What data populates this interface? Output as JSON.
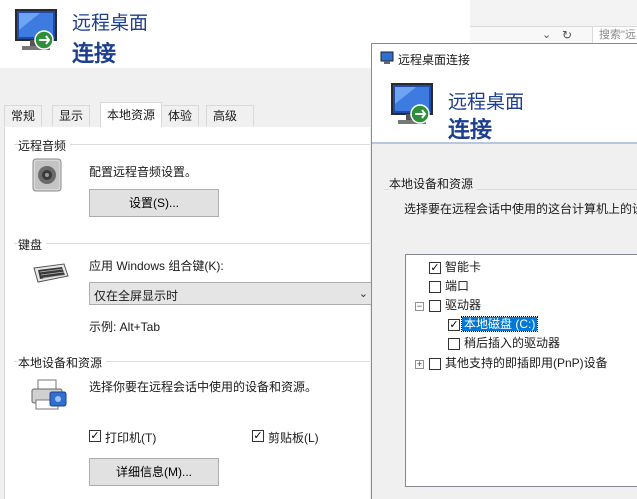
{
  "back": {
    "banner_line1": "远程桌面",
    "banner_line2": "连接",
    "tabs": [
      "常规",
      "显示",
      "本地资源",
      "体验",
      "高级"
    ],
    "audio": {
      "group_label": "远程音频",
      "description": "配置远程音频设置。",
      "settings_button": "设置(S)..."
    },
    "keyboard": {
      "group_label": "键盘",
      "description": "应用 Windows 组合键(K):",
      "combo_value": "仅在全屏显示时",
      "example": "示例: Alt+Tab"
    },
    "devices": {
      "group_label": "本地设备和资源",
      "description": "选择你要在远程会话中使用的设备和资源。",
      "printer_label": "打印机(T)",
      "clipboard_label": "剪贴板(L)",
      "details_button": "详细信息(M)..."
    }
  },
  "browser": {
    "search_placeholder": "搜索\"远"
  },
  "dialog": {
    "title": "远程桌面连接",
    "banner_line1": "远程桌面",
    "banner_line2": "连接",
    "group_label": "本地设备和资源",
    "description": "选择要在远程会话中使用的这台计算机上的设",
    "tree": {
      "smart_card": "智能卡",
      "ports": "端口",
      "drives": "驱动器",
      "local_disk": "本地磁盘 (C:)",
      "later_drives": "稍后插入的驱动器",
      "pnp": "其他支持的即插即用(PnP)设备"
    }
  },
  "colors": {
    "accent_blue": "#1d3f8f",
    "selection": "#0078d7"
  }
}
